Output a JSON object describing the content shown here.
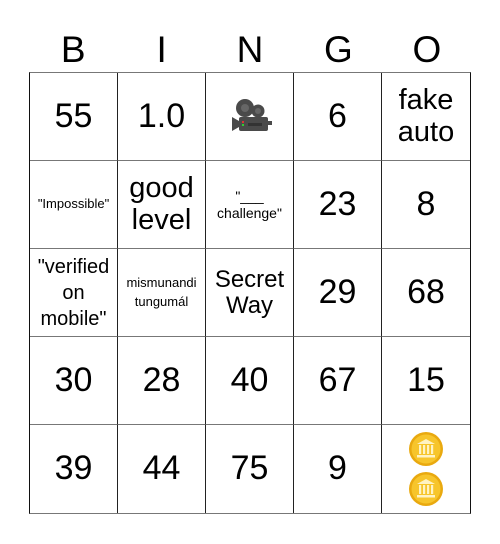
{
  "header": {
    "letters": [
      "B",
      "I",
      "N",
      "G",
      "O"
    ]
  },
  "cells": [
    {
      "text": "55"
    },
    {
      "text": "1.0"
    },
    {
      "icon": "movie-camera-icon"
    },
    {
      "text": "6"
    },
    {
      "text": "fake auto"
    },
    {
      "text": "\"Impossible\""
    },
    {
      "text": "good level"
    },
    {
      "text": "\"___ challenge\""
    },
    {
      "text": "23"
    },
    {
      "text": "8"
    },
    {
      "text": "\"verified on mobile\""
    },
    {
      "text": "mismunandi tungumál"
    },
    {
      "text": "Secret Way"
    },
    {
      "text": "29"
    },
    {
      "text": "68"
    },
    {
      "text": "30"
    },
    {
      "text": "28"
    },
    {
      "text": "40"
    },
    {
      "text": "67"
    },
    {
      "text": "15"
    },
    {
      "text": "39"
    },
    {
      "text": "44"
    },
    {
      "text": "75"
    },
    {
      "text": "9"
    },
    {
      "icon": "coin-icon",
      "count": 2
    }
  ],
  "colors": {
    "grid_line": "#777777",
    "coin": "#f5b81c"
  }
}
